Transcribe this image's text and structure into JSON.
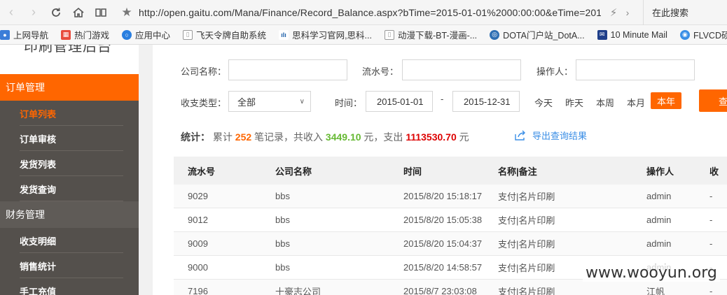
{
  "browser": {
    "url": "http://open.gaitu.com/Mana/Finance/Record_Balance.aspx?bTime=2015-01-01%2000:00:00&eTime=201",
    "search_placeholder": "在此搜索",
    "bookmarks": [
      {
        "label": "上网导航",
        "icon": "globe-icon",
        "color": "#3b7dd8"
      },
      {
        "label": "热门游戏",
        "icon": "game-icon",
        "color": "#e84c3d"
      },
      {
        "label": "应用中心",
        "icon": "app-center-icon",
        "color": "#2a7fe0"
      },
      {
        "label": "飞天令牌自助系统",
        "icon": "page-icon",
        "color": "#999999"
      },
      {
        "label": "思科学习官网,思科...",
        "icon": "cisco-icon",
        "color": "#1b5fa8"
      },
      {
        "label": "动漫下载-BT-漫画-...",
        "icon": "page-icon",
        "color": "#999999"
      },
      {
        "label": "DOTA门户站_DotA...",
        "icon": "dota-icon",
        "color": "#2f6fb3"
      },
      {
        "label": "10 Minute Mail",
        "icon": "mail-icon",
        "color": "#1f3f8a"
      },
      {
        "label": "FLVCD硕",
        "icon": "flvcd-icon",
        "color": "#3a8ee6"
      }
    ]
  },
  "sidebar": {
    "title": "印刷管理后台",
    "groups": [
      {
        "label": "订单管理",
        "items": [
          "订单列表",
          "订单审核",
          "发货列表",
          "发货查询"
        ]
      },
      {
        "label": "财务管理",
        "items": [
          "收支明细",
          "销售统计",
          "手工充值"
        ]
      }
    ]
  },
  "filters": {
    "company_label": "公司名称：",
    "serial_label": "流水号：",
    "operator_label": "操作人：",
    "type_label": "收支类型：",
    "type_value": "全部",
    "time_label": "时间：",
    "start_date": "2015-01-01",
    "end_date": "2015-12-31",
    "range_sep": "-",
    "quick": [
      "今天",
      "昨天",
      "本周",
      "本月",
      "本年"
    ],
    "query_button": "查"
  },
  "stats": {
    "label": "统计：",
    "p1": "累计",
    "count": "252",
    "p2": "笔记录，共收入",
    "income": "3449.10",
    "p3": "元，支出",
    "expense": "1113530.70",
    "p4": "元"
  },
  "export_label": "导出查询结果",
  "table": {
    "headers": [
      "流水号",
      "公司名称",
      "时间",
      "名称|备注",
      "操作人",
      "收"
    ],
    "rows": [
      [
        "9029",
        "bbs",
        "2015/8/20 15:18:17",
        "支付|名片印刷",
        "admin",
        "-"
      ],
      [
        "9012",
        "bbs",
        "2015/8/20 15:05:38",
        "支付|名片印刷",
        "admin",
        "-"
      ],
      [
        "9009",
        "bbs",
        "2015/8/20 15:04:37",
        "支付|名片印刷",
        "admin",
        "-"
      ],
      [
        "9000",
        "bbs",
        "2015/8/20 14:58:57",
        "支付|名片印刷",
        "admin",
        "-"
      ],
      [
        "7196",
        "十豪志公司",
        "2015/8/7 23:03:08",
        "支付|名片印刷",
        "江帆",
        "-"
      ]
    ]
  },
  "watermark": "www.wooyun.org"
}
